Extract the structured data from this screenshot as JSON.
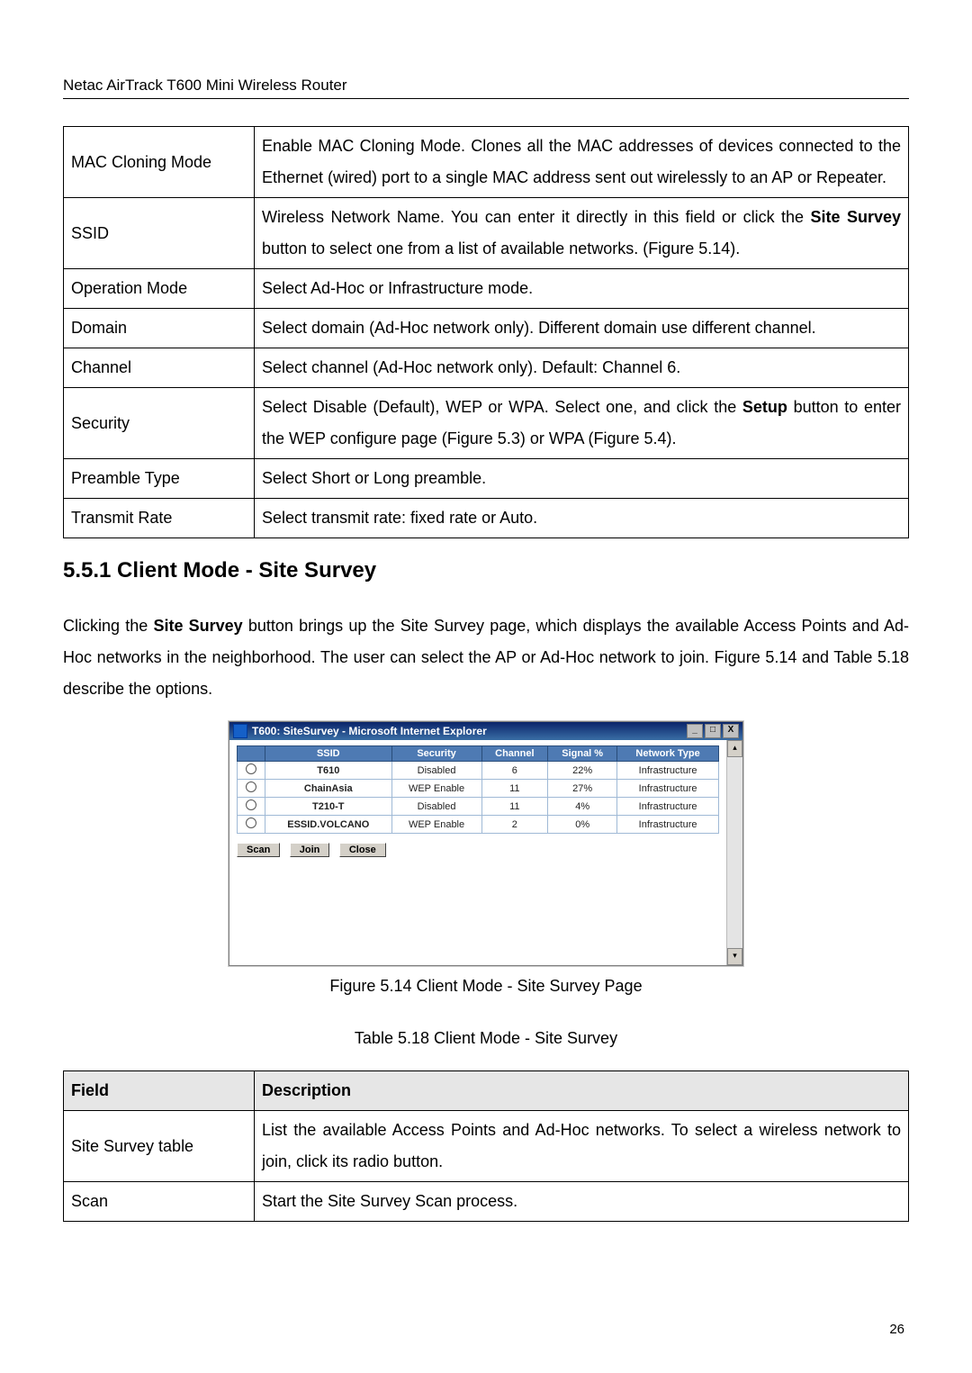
{
  "header": "Netac AirTrack T600 Mini Wireless Router",
  "page_number": "26",
  "def_table": {
    "rows": [
      {
        "field": "MAC Cloning Mode",
        "desc": "Enable MAC Cloning Mode. Clones all the MAC addresses of devices connected to the Ethernet (wired) port to a single MAC address sent out wirelessly to an AP or Repeater."
      },
      {
        "field": "SSID",
        "desc_pre": "Wireless Network Name. You can enter it directly in this field or click the ",
        "desc_bold1": "Site Survey",
        "desc_post": " button to select one from a list of available networks. (Figure 5.14)."
      },
      {
        "field": "Operation Mode",
        "desc": "Select Ad-Hoc or Infrastructure mode."
      },
      {
        "field": "Domain",
        "desc": "Select domain (Ad-Hoc network only). Different domain use different channel."
      },
      {
        "field": "Channel",
        "desc": "Select channel (Ad-Hoc network only). Default: Channel 6."
      },
      {
        "field": "Security",
        "desc_pre": "Select Disable (Default), WEP or WPA. Select one, and click the ",
        "desc_bold1": "Setup",
        "desc_post": " button to enter the WEP configure page (Figure 5.3) or WPA (Figure 5.4)."
      },
      {
        "field": "Preamble Type",
        "desc": "Select Short or Long preamble."
      },
      {
        "field": "Transmit Rate",
        "desc": "Select transmit rate: fixed rate or Auto."
      }
    ]
  },
  "section_heading": "5.5.1 Client Mode - Site Survey",
  "section_body": {
    "pre": "Clicking the ",
    "bold": "Site Survey",
    "post": " button brings up the Site Survey page, which displays the available Access Points and Ad-Hoc networks in the neighborhood. The user can select the AP or Ad-Hoc network to join. Figure 5.14 and Table 5.18 describe the options."
  },
  "ie_window": {
    "title": "T600: SiteSurvey - Microsoft Internet Explorer",
    "headers": [
      "SSID",
      "Security",
      "Channel",
      "Signal %",
      "Network Type"
    ],
    "rows": [
      {
        "ssid": "T610",
        "security": "Disabled",
        "channel": "6",
        "signal": "22%",
        "type": "Infrastructure"
      },
      {
        "ssid": "ChainAsia",
        "security": "WEP Enable",
        "channel": "11",
        "signal": "27%",
        "type": "Infrastructure"
      },
      {
        "ssid": "T210-T",
        "security": "Disabled",
        "channel": "11",
        "signal": "4%",
        "type": "Infrastructure"
      },
      {
        "ssid": "ESSID.VOLCANO",
        "security": "WEP Enable",
        "channel": "2",
        "signal": "0%",
        "type": "Infrastructure"
      }
    ],
    "buttons": {
      "scan": "Scan",
      "join": "Join",
      "close": "Close"
    },
    "window_buttons": {
      "min": "_",
      "max": "□",
      "close": "X"
    },
    "scroll_up": "▴",
    "scroll_down": "▾"
  },
  "figure_caption": "Figure 5.14 Client Mode - Site Survey Page",
  "table_caption": "Table 5.18 Client Mode - Site Survey",
  "fielddesc_table": {
    "headers": {
      "field": "Field",
      "desc": "Description"
    },
    "rows": [
      {
        "field": "Site Survey table",
        "desc": "List the available Access Points and Ad-Hoc networks. To select a wireless network to join, click its radio button."
      },
      {
        "field": "Scan",
        "desc": "Start the Site Survey Scan process."
      }
    ]
  }
}
